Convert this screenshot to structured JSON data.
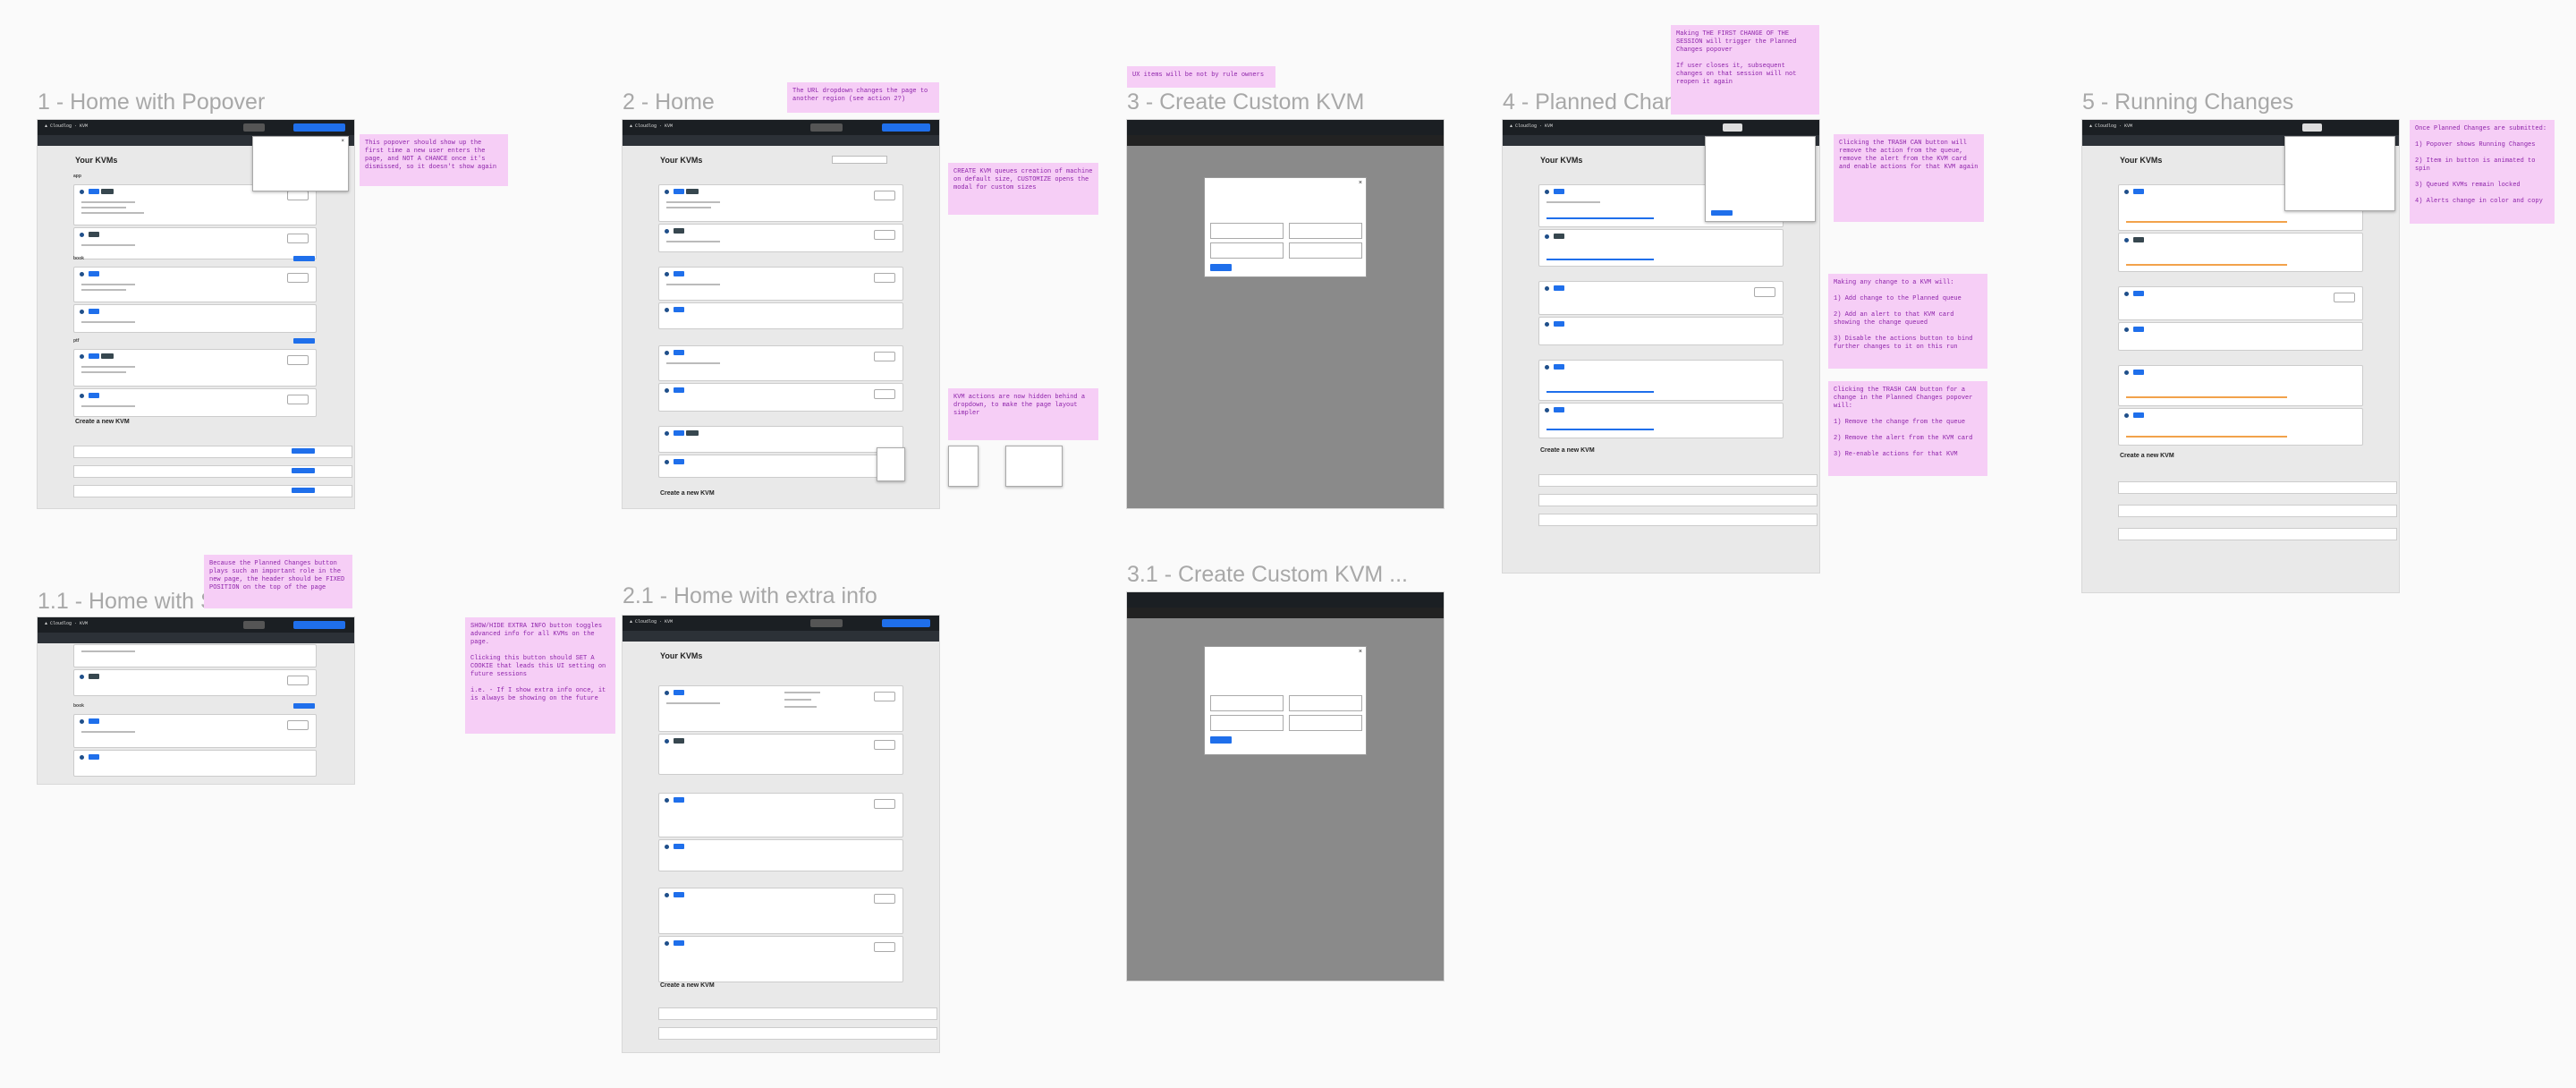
{
  "frames": [
    {
      "id": "f1",
      "title": "1 - Home with Popover"
    },
    {
      "id": "f11",
      "title": "1.1 - Home with Scroll"
    },
    {
      "id": "f2",
      "title": "2 - Home"
    },
    {
      "id": "f21",
      "title": "2.1 - Home with extra info"
    },
    {
      "id": "f3",
      "title": "3 - Create Custom KVM"
    },
    {
      "id": "f31",
      "title": "3.1 - Create Custom KVM ..."
    },
    {
      "id": "f4",
      "title": "4 - Planned Changes"
    },
    {
      "id": "f5",
      "title": "5 - Running Changes"
    }
  ],
  "notes": {
    "n_popover": "This popover should show up the first time a new user enters the page, and NOT A CHANCE once it's dismissed, so it doesn't show again",
    "n_planned_button": "Because the Planned Changes button plays such an important role in the new page, the header should be FIXED POSITION on the top of the page",
    "n_show_extra": "SHOW/HIDE EXTRA INFO button toggles advanced info for all KVMs on the page.\n\nClicking this button should SET A COOKIE that leads this UI setting on future sessions\n\ni.e. - If I show extra info once, it is always be showing on the future",
    "n_url_dropdown": "The URL dropdown changes the page to another region (see action 2?)",
    "n_create": "CREATE KVM queues creation of machine on default size, CUSTOMIZE opens the modal for custom sizes",
    "n_actions": "KVM actions are now hidden behind a dropdown, to make the page layout simpler",
    "n_modal": "UX items will be not by rule owners",
    "n_first_change": "Making THE FIRST CHANGE OF THE SESSION will trigger the Planned Changes popover\n\nIf user closes it, subsequent changes on that session will not reopen it again",
    "n_trash": "Clicking the TRASH CAN button will remove the action from the queue, remove the alert from the KVM card and enable actions for that KVM again",
    "n_any_change": "Making any change to a KVM will:\n\n1) Add change to the Planned queue\n\n2) Add an alert to that KVM card showing the change queued\n\n3) Disable the actions button to bind further changes to it on this run",
    "n_trash2": "Clicking the TRASH CAN button for a change in the Planned Changes popover will:\n\n1) Remove the change from the queue\n\n2) Remove the alert from the KVM card\n\n3) Re-enable actions for that KVM",
    "n_running": "Once Planned Changes are submitted:\n\n1) Popover shows Running Changes\n\n2) Item in button is animated to spin\n\n3) Queued KVMs remain locked\n\n4) Alerts change in color and copy"
  },
  "ui": {
    "page_heading": "Your KVMs",
    "create_heading": "Create a new KVM"
  }
}
